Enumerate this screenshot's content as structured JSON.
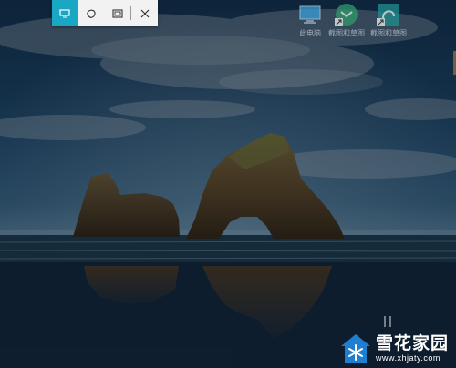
{
  "toolbar": {
    "buttons": [
      {
        "name": "rectangle-snip",
        "icon": "rectangle-icon",
        "active": true
      },
      {
        "name": "freeform-snip",
        "icon": "freeform-icon",
        "active": false
      },
      {
        "name": "fullscreen-snip",
        "icon": "fullscreen-icon",
        "active": false
      },
      {
        "name": "close",
        "icon": "close-icon",
        "active": false
      }
    ],
    "accent": "#1aa7c4"
  },
  "desktop_icons": [
    {
      "label": "此电脑",
      "icon": "computer-icon"
    },
    {
      "label": "截图和草图",
      "icon": "snip-app-icon"
    },
    {
      "label": "截图和草图",
      "icon": "snip-sketch-icon"
    }
  ],
  "watermark": {
    "title": "雪花家园",
    "url": "www.xhjaty.com"
  }
}
